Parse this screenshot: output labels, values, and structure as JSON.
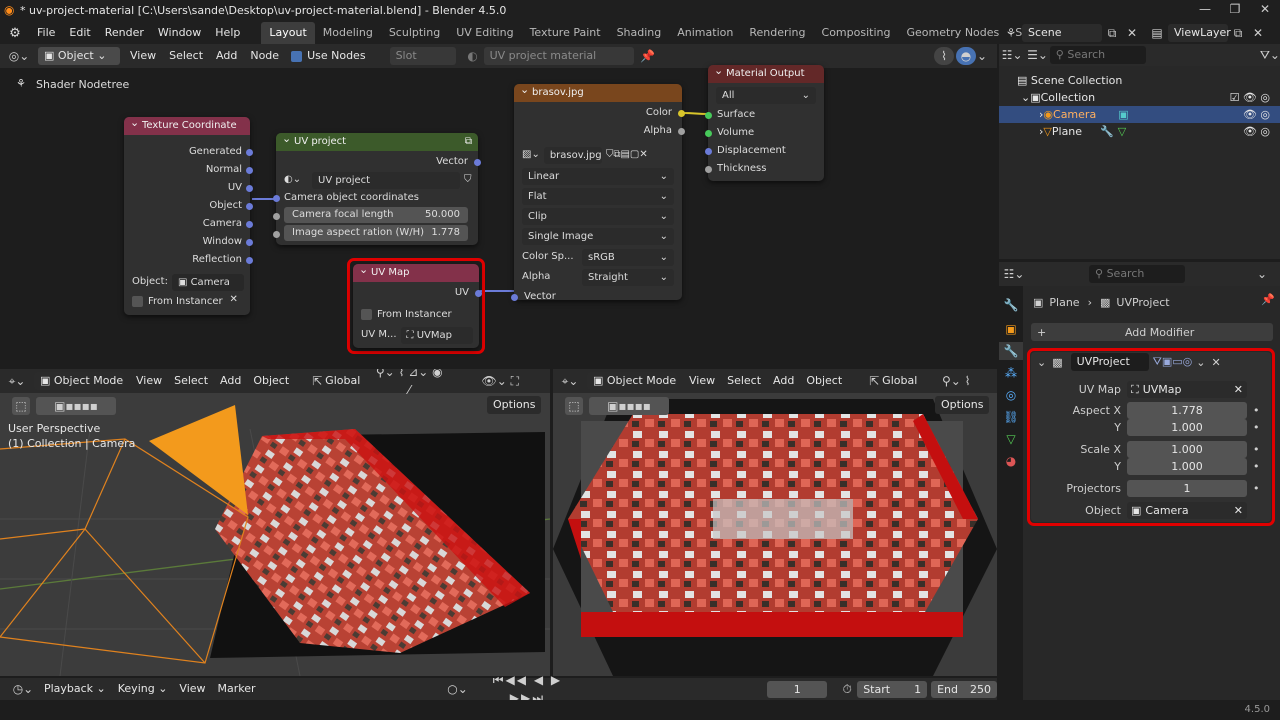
{
  "window": {
    "title": "* uv-project-material [C:\\Users\\sande\\Desktop\\uv-project-material.blend] - Blender 4.5.0",
    "version": "4.5.0"
  },
  "menus": [
    "File",
    "Edit",
    "Render",
    "Window",
    "Help"
  ],
  "workspaces": [
    "Layout",
    "Modeling",
    "Sculpting",
    "UV Editing",
    "Texture Paint",
    "Shading",
    "Animation",
    "Rendering",
    "Compositing",
    "Geometry Nodes",
    "Scripting"
  ],
  "workspace_add": "+",
  "scene": {
    "label": "Scene",
    "viewlayer": "ViewLayer"
  },
  "node_editor": {
    "object_dropdown": "Object",
    "menu": [
      "View",
      "Select",
      "Add",
      "Node"
    ],
    "use_nodes_label": "Use Nodes",
    "slot_label": "Slot",
    "material_name": "UV project material",
    "breadcrumb": "Shader Nodetree"
  },
  "nodes": {
    "texcoord": {
      "title": "Texture Coordinate",
      "outputs": [
        "Generated",
        "Normal",
        "UV",
        "Object",
        "Camera",
        "Window",
        "Reflection"
      ],
      "object_label": "Object:",
      "object_value": "Camera",
      "from_instancer": "From Instancer"
    },
    "uvproject": {
      "title": "UV project",
      "output": "Vector",
      "group_name": "UV project",
      "input_camera": "Camera object coordinates",
      "focal_label": "Camera focal length",
      "focal_value": "50.000",
      "aspect_label": "Image aspect ration (W/H)",
      "aspect_value": "1.778"
    },
    "uvmap": {
      "title": "UV Map",
      "output": "UV",
      "from_instancer": "From Instancer",
      "map_label": "UV M...",
      "map_value": "UVMap"
    },
    "image": {
      "title": "brasov.jpg",
      "out_color": "Color",
      "out_alpha": "Alpha",
      "image_name": "brasov.jpg",
      "interpolation": "Linear",
      "projection": "Flat",
      "extension": "Clip",
      "source": "Single Image",
      "colorspace_label": "Color Sp...",
      "colorspace": "sRGB",
      "alpha_label": "Alpha",
      "alpha_value": "Straight",
      "in_vector": "Vector"
    },
    "output": {
      "title": "Material Output",
      "target": "All",
      "inputs": [
        "Surface",
        "Volume",
        "Displacement",
        "Thickness"
      ]
    }
  },
  "viewport_left": {
    "mode": "Object Mode",
    "menu": [
      "View",
      "Select",
      "Add",
      "Object"
    ],
    "orientation": "Global",
    "options": "Options",
    "perspective": "User Perspective",
    "collection": "(1) Collection | Camera"
  },
  "viewport_right": {
    "mode": "Object Mode",
    "menu": [
      "View",
      "Select",
      "Add",
      "Object"
    ],
    "orientation": "Global",
    "options": "Options"
  },
  "outliner": {
    "search_placeholder": "Search",
    "scene_collection": "Scene Collection",
    "collection": "Collection",
    "camera": "Camera",
    "plane": "Plane"
  },
  "properties": {
    "search_placeholder": "Search",
    "breadcrumb_object": "Plane",
    "breadcrumb_modifier": "UVProject",
    "add_modifier": "Add Modifier",
    "modifier_name": "UVProject",
    "uvmap_label": "UV Map",
    "uvmap_value": "UVMap",
    "aspect_x_label": "Aspect X",
    "aspect_x": "1.778",
    "aspect_y_label": "Y",
    "aspect_y": "1.000",
    "scale_x_label": "Scale X",
    "scale_x": "1.000",
    "scale_y_label": "Y",
    "scale_y": "1.000",
    "projectors_label": "Projectors",
    "projectors": "1",
    "object_label": "Object",
    "object_value": "Camera"
  },
  "timeline": {
    "menu": [
      "Playback",
      "Keying",
      "View",
      "Marker"
    ],
    "current_frame": "1",
    "start_label": "Start",
    "start": "1",
    "end_label": "End",
    "end": "250"
  },
  "colors": {
    "texcoord_header": "#83314a",
    "group_header": "#3c5a2a",
    "uvmap_header": "#83314a",
    "image_header": "#79461d",
    "output_header": "#632828",
    "highlight": "#e00000"
  }
}
